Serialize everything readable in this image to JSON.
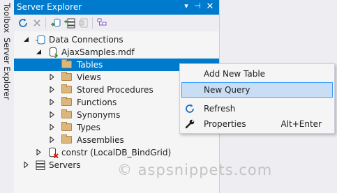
{
  "side_tabs": [
    "Toolbox",
    "Server Explorer"
  ],
  "window": {
    "title": "Server Explorer"
  },
  "tree": {
    "data_connections": "Data Connections",
    "database": "AjaxSamples.mdf",
    "folders": [
      "Tables",
      "Views",
      "Stored Procedures",
      "Functions",
      "Synonyms",
      "Types",
      "Assemblies"
    ],
    "other_connection": "constr (LocalDB_BindGrid)",
    "servers": "Servers"
  },
  "context_menu": {
    "items": [
      {
        "label": "Add New Table",
        "shortcut": "",
        "icon": ""
      },
      {
        "label": "New Query",
        "shortcut": "",
        "icon": ""
      },
      {
        "label": "Refresh",
        "shortcut": "",
        "icon": "refresh-icon"
      },
      {
        "label": "Properties",
        "shortcut": "Alt+Enter",
        "icon": "wrench-icon"
      }
    ],
    "highlighted": "New Query"
  },
  "watermark": "© aspsnippets.com",
  "colors": {
    "accent": "#007acc",
    "selection": "#007acc",
    "menu_highlight": "#c9def5",
    "folder": "#dcb67a"
  }
}
